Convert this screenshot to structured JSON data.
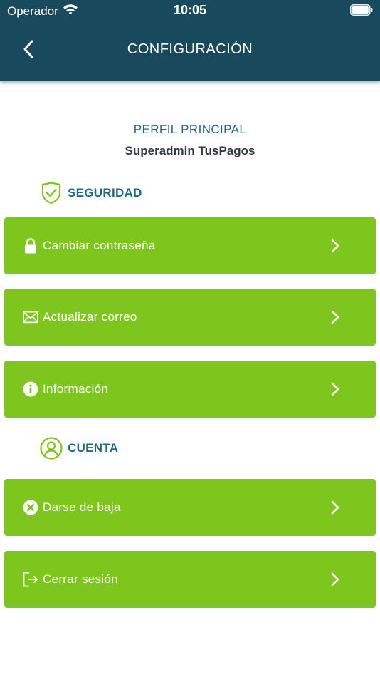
{
  "status_bar": {
    "carrier": "Operador",
    "time": "10:05"
  },
  "nav": {
    "title": "CONFIGURACIÓN",
    "back_icon": "chevron-left-icon"
  },
  "profile": {
    "label": "PERFIL PRINCIPAL",
    "name": "Superadmin TusPagos"
  },
  "sections": {
    "security": {
      "label": "SEGURIDAD",
      "icon": "shield-check-icon"
    },
    "account": {
      "label": "CUENTA",
      "icon": "user-circle-icon"
    }
  },
  "items": {
    "change_password": {
      "label": "Cambiar contraseña",
      "icon": "lock-icon"
    },
    "update_email": {
      "label": "Actualizar correo",
      "icon": "envelope-icon"
    },
    "info": {
      "label": "Información",
      "icon": "info-icon"
    },
    "unsubscribe": {
      "label": "Darse de baja",
      "icon": "close-circle-icon"
    },
    "logout": {
      "label": "Cerrar sesión",
      "icon": "logout-icon"
    }
  },
  "colors": {
    "header": "#18495c",
    "accent": "#7ec61d",
    "section_text": "#1e6c82",
    "name_text": "#333a3d"
  }
}
